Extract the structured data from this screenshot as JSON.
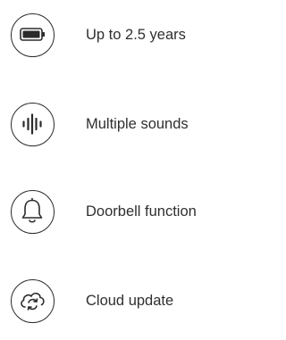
{
  "features": [
    {
      "label": "Up to 2.5 years",
      "icon": "battery-icon"
    },
    {
      "label": "Multiple sounds",
      "icon": "sound-wave-icon"
    },
    {
      "label": "Doorbell function",
      "icon": "bell-icon"
    },
    {
      "label": "Cloud update",
      "icon": "cloud-sync-icon"
    }
  ],
  "colors": {
    "icon_stroke": "#2b2b2b",
    "text": "#2f2f2f",
    "background": "#ffffff"
  }
}
